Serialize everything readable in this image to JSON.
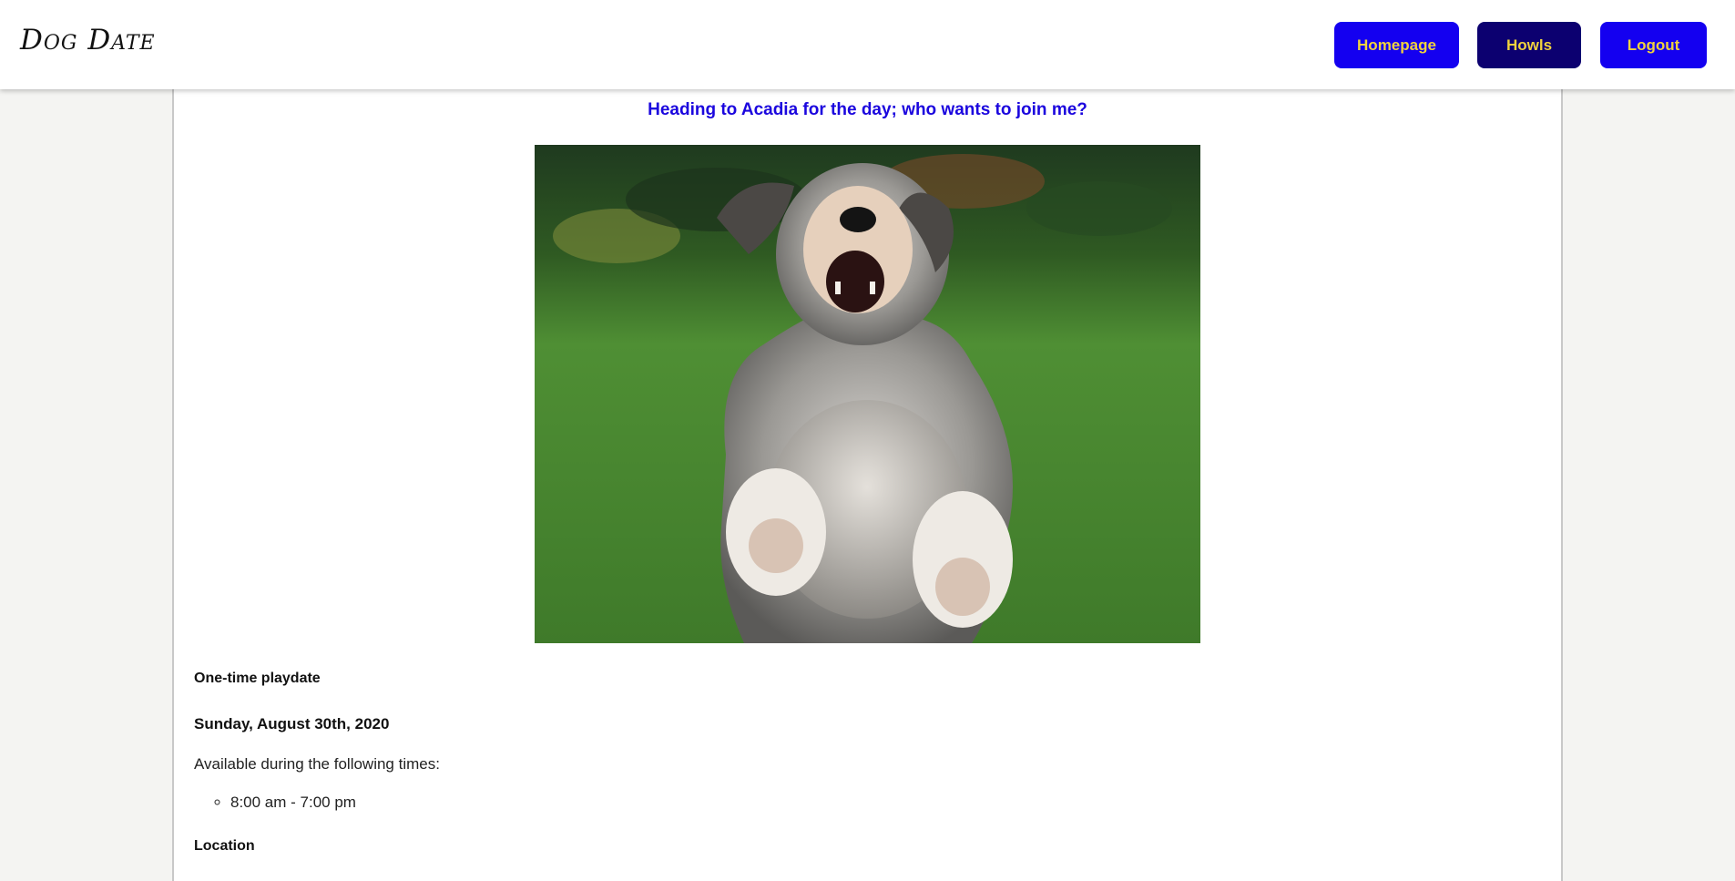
{
  "header": {
    "brand": "Dog Date",
    "nav": {
      "homepage": "Homepage",
      "howls": "Howls",
      "logout": "Logout"
    },
    "colors": {
      "button": "#1400f0",
      "button_active": "#0c0070",
      "button_text": "#f0d23e"
    }
  },
  "post": {
    "title": "Heading to Acadia for the day; who wants to join me?",
    "frequency": "One-time playdate",
    "date": "Sunday, August 30th, 2020",
    "availability_label": "Available during the following times:",
    "times": [
      "8:00 am - 7:00 pm"
    ],
    "location_label": "Location"
  }
}
